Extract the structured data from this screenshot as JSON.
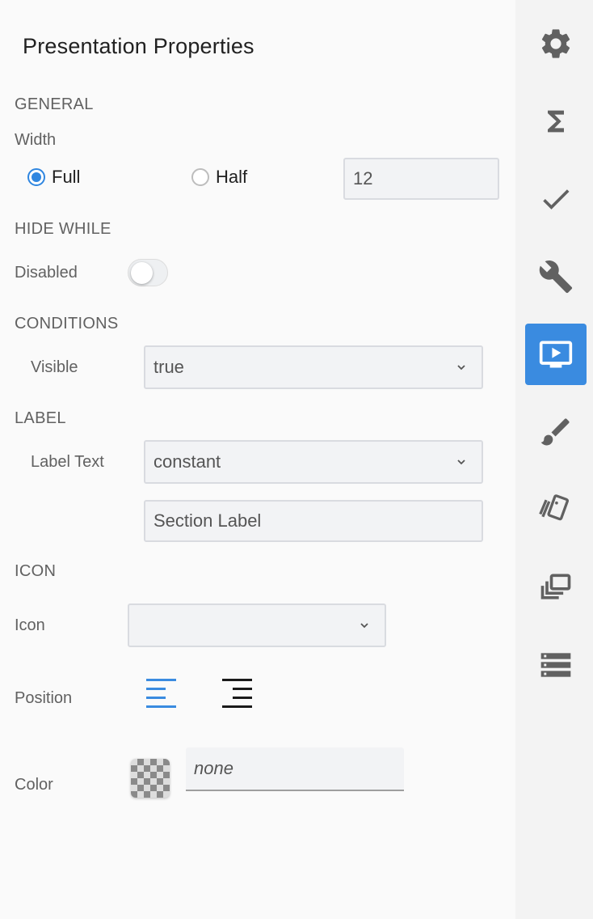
{
  "title": "Presentation Properties",
  "general": {
    "heading": "GENERAL",
    "width_label": "Width",
    "option_full": "Full",
    "option_half": "Half",
    "columns_value": "12",
    "selected": "Full"
  },
  "hide_while": {
    "heading": "HIDE WHILE",
    "disabled_label": "Disabled",
    "disabled_on": false
  },
  "conditions": {
    "heading": "CONDITIONS",
    "visible_label": "Visible",
    "visible_value": "true"
  },
  "label": {
    "heading": "LABEL",
    "label_text_label": "Label Text",
    "label_text_mode": "constant",
    "label_text_value": "Section Label"
  },
  "icon": {
    "heading": "ICON",
    "icon_label": "Icon",
    "icon_value": "",
    "position_label": "Position",
    "position_selected": "left",
    "color_label": "Color",
    "color_value": "none"
  },
  "rail": {
    "items": [
      {
        "icon": "gear-icon"
      },
      {
        "icon": "sigma-icon"
      },
      {
        "icon": "check-icon"
      },
      {
        "icon": "wrench-icon"
      },
      {
        "icon": "presentation-icon",
        "active": true
      },
      {
        "icon": "brush-icon"
      },
      {
        "icon": "cards-icon"
      },
      {
        "icon": "layers-icon"
      },
      {
        "icon": "rows-icon"
      }
    ]
  },
  "colors": {
    "accent": "#3a8be0",
    "align_active": "#3a8be0",
    "align_inactive": "#1a1a1a",
    "rail_icon": "#616161"
  }
}
